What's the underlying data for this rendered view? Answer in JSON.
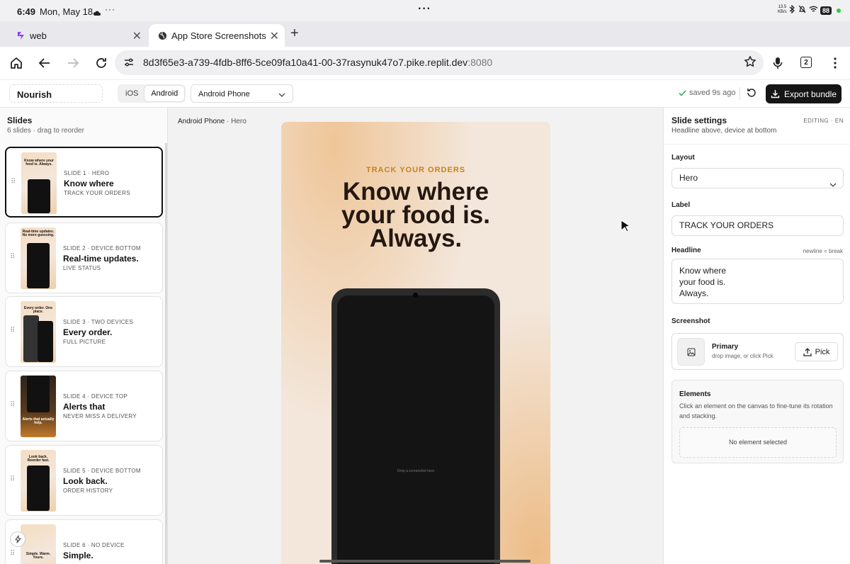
{
  "status_bar": {
    "time": "6:49",
    "date": "Mon, May 18",
    "net_speed": "13.5\nKB/s",
    "battery": "88"
  },
  "tabs": [
    {
      "title": "web",
      "active": false
    },
    {
      "title": "App Store Screenshots",
      "active": true
    }
  ],
  "address": {
    "url": "8d3f65e3-a739-4fdb-8ff6-5ce09fa10a41-00-37rasynuk47o7.pike.replit.dev",
    "port": ":8080",
    "tab_count": "2"
  },
  "toolbar": {
    "project_name": "Nourish",
    "platforms": [
      "iOS",
      "Android"
    ],
    "selected_platform": "Android",
    "device": "Android Phone",
    "save_status": "saved 9s ago",
    "export_label": "Export bundle"
  },
  "slides_panel": {
    "title": "Slides",
    "subtitle": "6 slides · drag to reorder",
    "slides": [
      {
        "tag": "SLIDE 1 · HERO",
        "headline": "Know where",
        "label": "TRACK YOUR ORDERS",
        "thumb_text": "Know where your food is. Always."
      },
      {
        "tag": "SLIDE 2 · DEVICE BOTTOM",
        "headline": "Real-time updates.",
        "label": "LIVE STATUS",
        "thumb_text": "Real-time updates. No more guessing."
      },
      {
        "tag": "SLIDE 3 · TWO DEVICES",
        "headline": "Every order.",
        "label": "FULL PICTURE",
        "thumb_text": "Every order. One place."
      },
      {
        "tag": "SLIDE 4 · DEVICE TOP",
        "headline": "Alerts that",
        "label": "NEVER MISS A DELIVERY",
        "thumb_text": "Alerts that actually help."
      },
      {
        "tag": "SLIDE 5 · DEVICE BOTTOM",
        "headline": "Look back.",
        "label": "ORDER HISTORY",
        "thumb_text": "Look back. Reorder fast."
      },
      {
        "tag": "SLIDE 6 · NO DEVICE",
        "headline": "Simple.",
        "label": "",
        "thumb_text": "Simple. Warm. Yours."
      }
    ]
  },
  "canvas": {
    "breadcrumb_device": "Android Phone",
    "breadcrumb_sep": "·",
    "breadcrumb_layout": "Hero",
    "label": "TRACK YOUR ORDERS",
    "headline": "Know where\nyour food is.\nAlways.",
    "drop_hint": "Drop a screenshot here"
  },
  "settings": {
    "title": "Slide settings",
    "subtitle": "Headline above, device at bottom",
    "editing": "EDITING · EN",
    "layout_label": "Layout",
    "layout_value": "Hero",
    "label_label": "Label",
    "label_value": "TRACK YOUR ORDERS",
    "headline_label": "Headline",
    "headline_hint": "newline = break",
    "headline_value": "Know where\nyour food is.\nAlways.",
    "screenshot_label": "Screenshot",
    "screenshot_title": "Primary",
    "screenshot_sub": "drop image, or click Pick",
    "pick_label": "Pick",
    "elements_title": "Elements",
    "elements_desc": "Click an element on the canvas to fine-tune its rotation and stacking.",
    "elements_empty": "No element selected"
  },
  "colors": {
    "accent_label": "#c9821f",
    "headline": "#241811",
    "export_bg": "#151515",
    "saved_check": "#2ea44f"
  }
}
